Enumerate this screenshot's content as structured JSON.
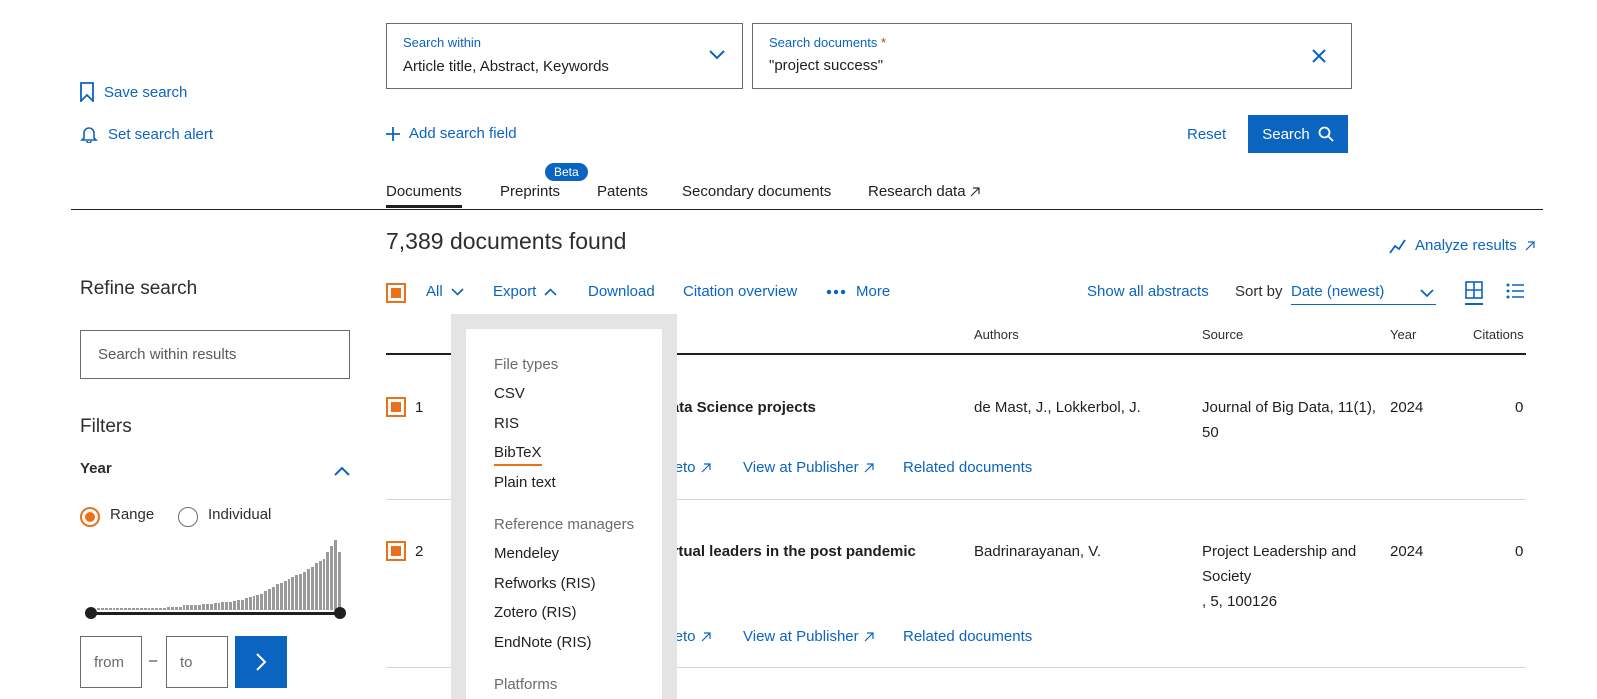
{
  "search": {
    "within_label": "Search within",
    "within_value": "Article title, Abstract, Keywords",
    "docs_label": "Search documents",
    "docs_required": "*",
    "docs_value": "\"project success\"",
    "add_field": "Add search field",
    "reset": "Reset",
    "search_button": "Search"
  },
  "side_actions": {
    "save_search": "Save search",
    "set_alert": "Set search alert"
  },
  "tabs": [
    {
      "label": "Documents",
      "active": true
    },
    {
      "label": "Preprints",
      "badge": "Beta"
    },
    {
      "label": "Patents"
    },
    {
      "label": "Secondary documents"
    },
    {
      "label": "Research data"
    }
  ],
  "results": {
    "count_text": "7,389 documents found",
    "analyze": "Analyze results"
  },
  "toolbar": {
    "all": "All",
    "export": "Export",
    "download": "Download",
    "citation_overview": "Citation overview",
    "more": "More",
    "show_abstracts": "Show all abstracts",
    "sort_by": "Sort by",
    "sort_value": "Date (newest)"
  },
  "columns": {
    "authors": "Authors",
    "source": "Source",
    "year": "Year",
    "citations": "Citations"
  },
  "rows": [
    {
      "num": "1",
      "title_visible": "Data Science projects",
      "authors": "de Mast, J., Lokkerbol, J.",
      "source_line1": "Journal of Big Data, 11(1),",
      "source_line2": "50",
      "source_line3": "",
      "year": "2024",
      "citations": "0",
      "link_partial": "pleto",
      "view_publisher": "View at Publisher",
      "related": "Related documents"
    },
    {
      "num": "2",
      "title_visible": "virtual leaders in the post pandemic",
      "authors": "Badrinarayanan, V.",
      "source_line1": "Project Leadership and",
      "source_line2": "Society",
      "source_line3": ", 5, 100126",
      "year": "2024",
      "citations": "0",
      "link_partial": "pleto",
      "view_publisher": "View at Publisher",
      "related": "Related documents"
    }
  ],
  "left_panel": {
    "refine": "Refine search",
    "within_placeholder": "Search within results",
    "filters": "Filters",
    "year": "Year",
    "range": "Range",
    "individual": "Individual",
    "from": "from",
    "to": "to",
    "dash": "–",
    "histogram": [
      1,
      1,
      1,
      1,
      1,
      1,
      1,
      1,
      1,
      1,
      1,
      1,
      2,
      2,
      2,
      2,
      2,
      2,
      3,
      3,
      3,
      3,
      4,
      4,
      4,
      4,
      4,
      5,
      5,
      5,
      6,
      6,
      7,
      7,
      7,
      8,
      9,
      9,
      10,
      11,
      12,
      13,
      14,
      16,
      18,
      20,
      22,
      23,
      25,
      27,
      28,
      30,
      31,
      33,
      35,
      37,
      40,
      42,
      44,
      50,
      55,
      60,
      50
    ],
    "range_fill": [
      0,
      1
    ]
  },
  "export_menu": {
    "file_types": "File types",
    "files": [
      "CSV",
      "RIS",
      "BibTeX",
      "Plain text"
    ],
    "ref_managers": "Reference managers",
    "managers": [
      "Mendeley",
      "Refworks (RIS)",
      "Zotero (RIS)",
      "EndNote (RIS)"
    ],
    "platforms": "Platforms"
  },
  "colors": {
    "accent": "#0b64c0",
    "checkbox": "#e9711c"
  }
}
